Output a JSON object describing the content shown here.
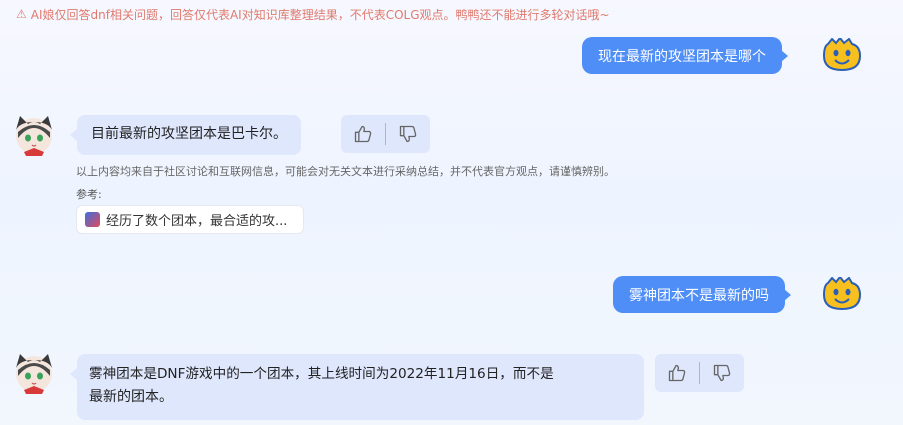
{
  "disclaimer": {
    "icon": "warning-icon",
    "text": "AI娘仅回答dnf相关问题，回答仅代表AI对知识库整理结果，不代表COLG观点。鸭鸭还不能进行多轮对话哦~"
  },
  "colors": {
    "user_bubble": "#4f8ef7",
    "bot_bubble": "#dfe7fd",
    "disclaimer": "#e07a6e"
  },
  "conversation": [
    {
      "role": "user",
      "avatar": "duck-avatar-icon",
      "text": "现在最新的攻坚团本是哪个"
    },
    {
      "role": "bot",
      "avatar": "cat-girl-avatar",
      "text": "目前最新的攻坚团本是巴卡尔。",
      "feedback": {
        "like_icon": "thumbs-up-icon",
        "dislike_icon": "thumbs-down-icon"
      },
      "notice": "以上内容均来自于社区讨论和互联网信息，可能会对无关文本进行采纳总结，并不代表官方观点，请谨慎辨别。",
      "reference_label": "参考:",
      "reference": {
        "icon": "game-icon",
        "title": "经历了数个团本，最合适的攻..."
      }
    },
    {
      "role": "user",
      "avatar": "duck-avatar-icon",
      "text": "雾神团本不是最新的吗"
    },
    {
      "role": "bot",
      "avatar": "cat-girl-avatar",
      "text_line1": "雾神团本是DNF游戏中的一个团本，其上线时间为2022年11月16日，而不是",
      "text_line2": "最新的团本。",
      "feedback": {
        "like_icon": "thumbs-up-icon",
        "dislike_icon": "thumbs-down-icon"
      }
    }
  ]
}
